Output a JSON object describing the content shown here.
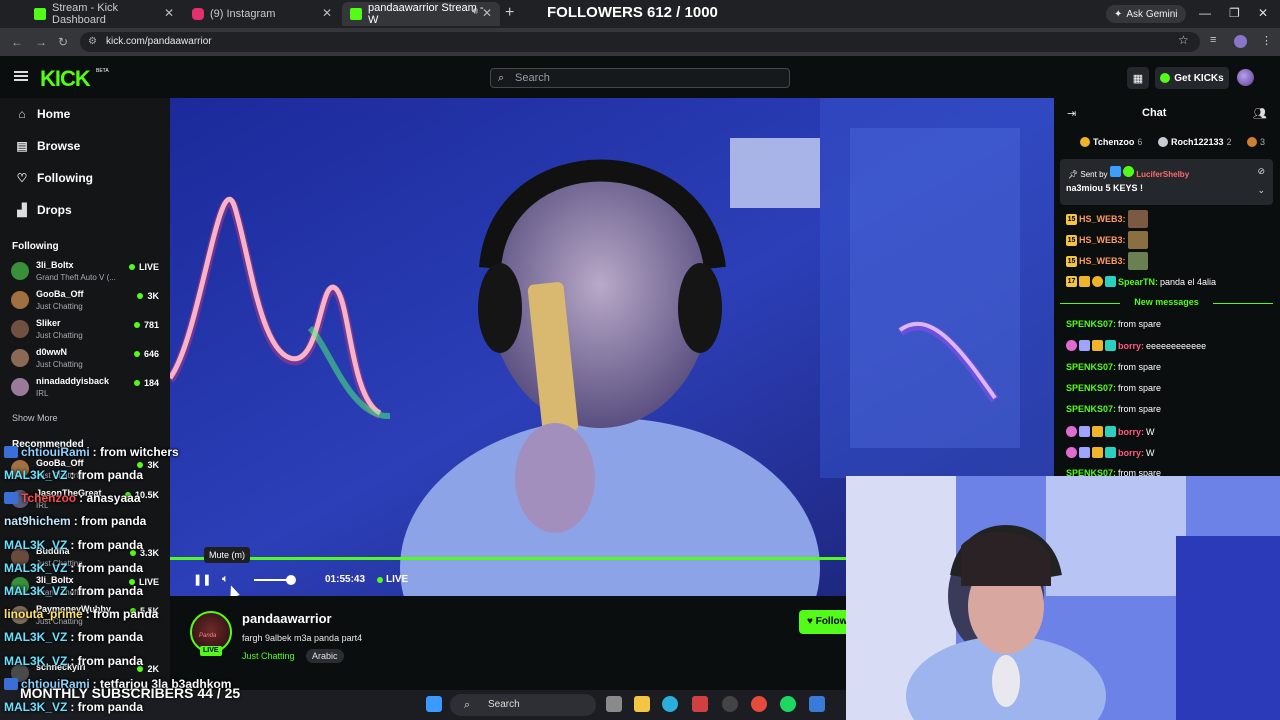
{
  "browser": {
    "tabs": [
      {
        "label": "Stream - Kick Dashboard",
        "color": "#53fc18"
      },
      {
        "label": "(9) Instagram",
        "color": "#e1306c"
      },
      {
        "label": "pandaawarrior Stream - W",
        "color": "#53fc18"
      }
    ],
    "url": "kick.com/pandaawarrior",
    "gemini": "Ask Gemini"
  },
  "overlay": {
    "followers": "FOLLOWERS 612 / 1000",
    "subscribers": "MONTHLY SUBSCRIBERS 44 / 25",
    "chat": [
      {
        "user": "chtiouiRami",
        "text": ": from witchers"
      },
      {
        "user": "MAL3K_VZ",
        "text": ": from panda"
      },
      {
        "user": "Tchenzoo",
        "text": ": anasyaaa"
      },
      {
        "user": "nat9hichem",
        "text": ": from panda"
      },
      {
        "user": "MAL3K_VZ",
        "text": ": from panda"
      },
      {
        "user": "MAL3K_VZ",
        "text": ": from panda"
      },
      {
        "user": "MAL3K_VZ",
        "text": ": from panda"
      },
      {
        "user": "linouta_prime",
        "text": ": from panda"
      },
      {
        "user": "MAL3K_VZ",
        "text": ": from panda"
      },
      {
        "user": "MAL3K_VZ",
        "text": ": from panda"
      },
      {
        "user": "chtiouiRami",
        "text": ": tetfarjou 3la b3adhkom"
      },
      {
        "user": "MAL3K_VZ",
        "text": ": from panda"
      }
    ]
  },
  "header": {
    "logo": "KICK",
    "beta": "BETA",
    "search_placeholder": "Search",
    "get_kicks": "Get KICKs"
  },
  "sidebar": {
    "nav": [
      {
        "label": "Home",
        "icon": "home-icon"
      },
      {
        "label": "Browse",
        "icon": "browse-icon"
      },
      {
        "label": "Following",
        "icon": "heart-icon"
      },
      {
        "label": "Drops",
        "icon": "drops-icon"
      }
    ],
    "following_title": "Following",
    "following": [
      {
        "name": "3li_Boltx",
        "sub": "Grand Theft Auto V (...",
        "viewers": "LIVE",
        "color": "#3a8f3a"
      },
      {
        "name": "GooBa_Off",
        "sub": "Just Chatting",
        "viewers": "3K",
        "color": "#a07040"
      },
      {
        "name": "Sliker",
        "sub": "Just Chatting",
        "viewers": "781",
        "color": "#705040"
      },
      {
        "name": "d0wwN",
        "sub": "Just Chatting",
        "viewers": "646",
        "color": "#8a6a55"
      },
      {
        "name": "ninadaddyisback",
        "sub": "IRL",
        "viewers": "184",
        "color": "#9a7a9a"
      }
    ],
    "show_more": "Show More",
    "recommended_title": "Recommended",
    "recommended": [
      {
        "name": "GooBa_Off",
        "sub": "Just Chatting",
        "viewers": "3K"
      },
      {
        "name": "JasonTheGreat",
        "sub": "IRL",
        "viewers": "10.5K"
      },
      {
        "name": "",
        "sub": "Just Chatting",
        "viewers": ""
      },
      {
        "name": "Buddha",
        "sub": "Just Chatting",
        "viewers": "3.3K"
      },
      {
        "name": "3li_Boltx",
        "sub": "Grand Theft Auto V",
        "viewers": "LIVE"
      },
      {
        "name": "PaymoneyWubby",
        "sub": "Just Chatting",
        "viewers": "5.5K"
      },
      {
        "name": "",
        "sub": "",
        "viewers": ""
      },
      {
        "name": "schneckyirl",
        "sub": "",
        "viewers": "2K"
      }
    ]
  },
  "player": {
    "tooltip": "Mute (m)",
    "time": "01:55:43",
    "live": "LIVE"
  },
  "stream": {
    "channel": "pandaawarrior",
    "avatar_text": "Panda",
    "live_badge": "LIVE",
    "title": "fargh 9albek m3a panda part4",
    "category": "Just Chatting",
    "tag": "Arabic",
    "follow": "Follow"
  },
  "chat": {
    "title": "Chat",
    "leaderboard": [
      {
        "name": "Tchenzoo",
        "count": "6",
        "color": "#f0b429"
      },
      {
        "name": "Roch122133",
        "count": "2",
        "color": "#c9ccd1"
      },
      {
        "name": "",
        "count": "3",
        "color": "#cd7f32"
      }
    ],
    "pinned": {
      "prefix": "Sent by",
      "user": "LuciferShelby",
      "message": "na3miou 5 KEYS !"
    },
    "messages": [
      {
        "badges": [
          "15"
        ],
        "user": "HS_WEB3:",
        "text": "",
        "user_color": "#ff9a5c",
        "emote": "#7a5a40"
      },
      {
        "badges": [
          "15"
        ],
        "user": "HS_WEB3:",
        "text": "",
        "user_color": "#ff9a5c",
        "emote": "#8a7040"
      },
      {
        "badges": [
          "15"
        ],
        "user": "HS_WEB3:",
        "text": "",
        "user_color": "#ff9a5c",
        "emote": "#6a8050"
      },
      {
        "badges": [
          "17"
        ],
        "user": "SpearTN:",
        "text": "panda el 4alia",
        "user_color": "#53fc18",
        "emote": ""
      }
    ],
    "new_messages": "New messages",
    "new": [
      {
        "user": "SPENKS07:",
        "text": "from spare",
        "user_color": "#53fc18",
        "badges": 0
      },
      {
        "user": "borry:",
        "text": "eeeeeeeeeeee",
        "user_color": "#ff5a7a",
        "badges": 4
      },
      {
        "user": "SPENKS07:",
        "text": "from spare",
        "user_color": "#53fc18",
        "badges": 0
      },
      {
        "user": "SPENKS07:",
        "text": "from spare",
        "user_color": "#53fc18",
        "badges": 0
      },
      {
        "user": "SPENKS07:",
        "text": "from spare",
        "user_color": "#53fc18",
        "badges": 0
      },
      {
        "user": "borry:",
        "text": "W",
        "user_color": "#ff5a7a",
        "badges": 4
      },
      {
        "user": "borry:",
        "text": "W",
        "user_color": "#ff5a7a",
        "badges": 4
      },
      {
        "user": "SPENKS07:",
        "text": "from spare",
        "user_color": "#53fc18",
        "badges": 0
      }
    ]
  },
  "taskbar": {
    "search": "Search"
  },
  "colors": {
    "kick_green": "#53fc18"
  }
}
